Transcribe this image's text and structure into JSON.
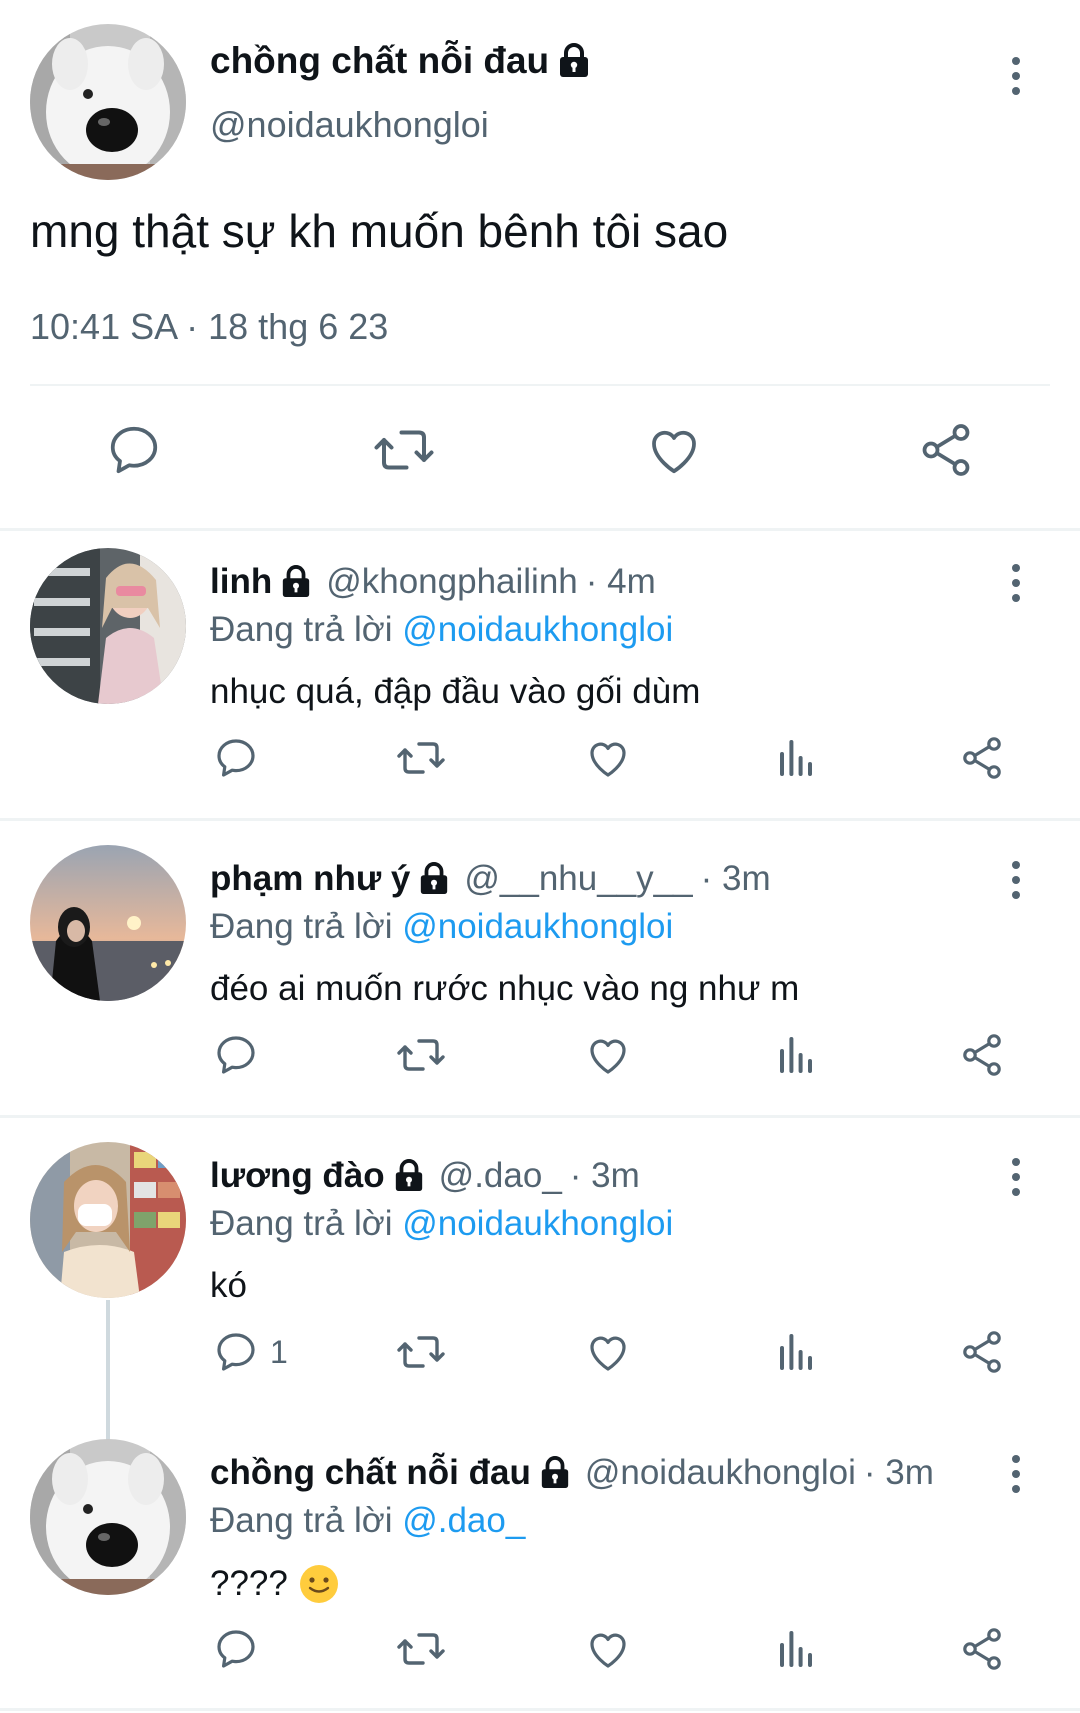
{
  "main_tweet": {
    "name": "chồng chất nỗi đau",
    "handle": "@noidaukhongloi",
    "text": "mng thật sự kh muốn bênh tôi sao",
    "timestamp": "10:41 SA · 18 thg 6 23",
    "locked": true,
    "actions": [
      "reply-icon",
      "retweet-icon",
      "like-icon",
      "share-icon"
    ]
  },
  "replies": [
    {
      "name": "linh",
      "handle": "@khongphailinh",
      "time": "· 4m",
      "replying_label": "Đang trả lời",
      "replying_to": "@noidaukhongloi",
      "text": "nhục quá, đập đầu vào gối dùm",
      "reply_count": ""
    },
    {
      "name": "phạm như ý",
      "handle": "@__nhu__y__",
      "time": "· 3m",
      "replying_label": "Đang trả lời",
      "replying_to": "@noidaukhongloi",
      "text": "đéo ai muốn rước nhục vào ng như m",
      "reply_count": ""
    },
    {
      "name": "lương đào",
      "handle": "@.dao_",
      "time": "· 3m",
      "replying_label": "Đang trả lời",
      "replying_to": "@noidaukhongloi",
      "text": "kó",
      "reply_count": "1"
    },
    {
      "name": "chồng chất nỗi đau",
      "handle": "@noidaukhongloi",
      "time": "· 3m",
      "replying_label": "Đang trả lời",
      "replying_to": "@.dao_",
      "text": "????",
      "emoji": "slightly-smiling-face-icon",
      "reply_count": ""
    }
  ],
  "colors": {
    "text": "#0f1419",
    "secondary": "#536471",
    "mention": "#1d9bf0",
    "divider": "#eff3f4"
  }
}
